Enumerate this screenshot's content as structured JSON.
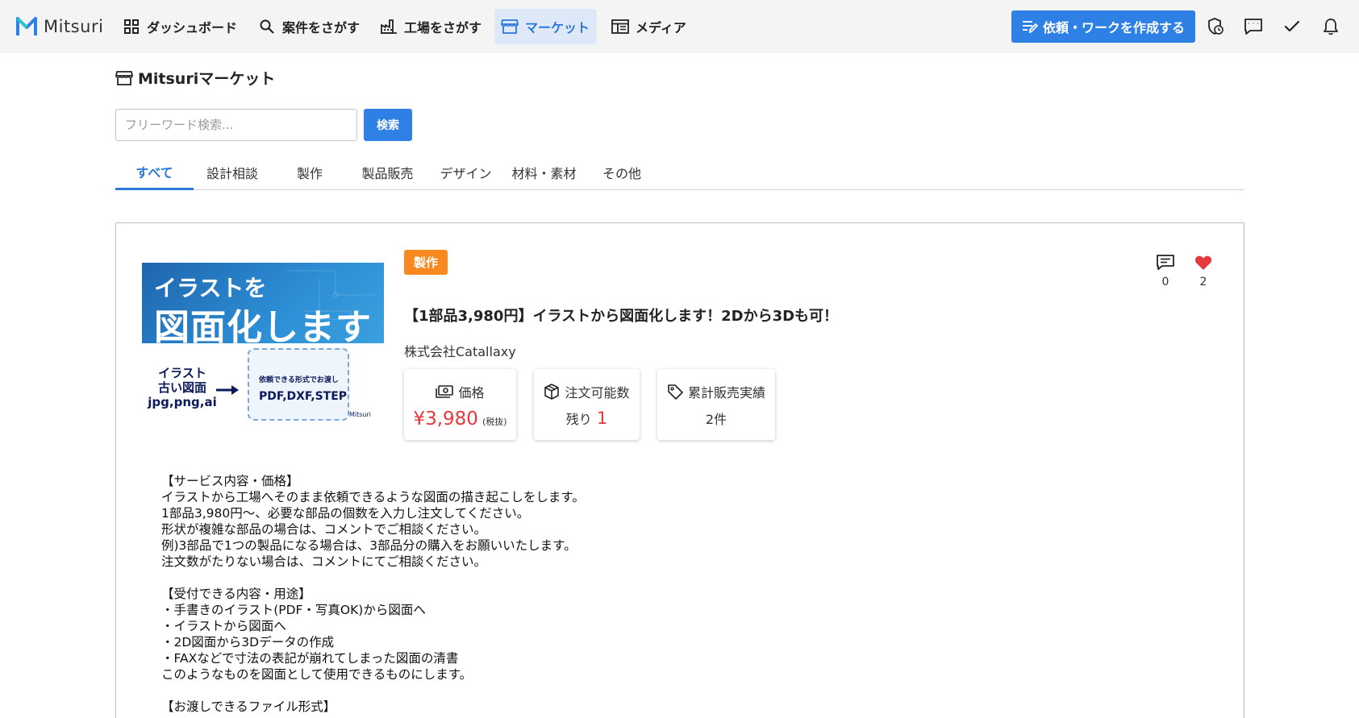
{
  "header": {
    "brand": "Mitsuri",
    "nav": [
      {
        "label": "ダッシュボード",
        "icon": "dashboard-grid-icon"
      },
      {
        "label": "案件をさがす",
        "icon": "search-icon"
      },
      {
        "label": "工場をさがす",
        "icon": "factory-icon"
      },
      {
        "label": "マーケット",
        "icon": "store-icon"
      },
      {
        "label": "メディア",
        "icon": "newspaper-icon"
      }
    ],
    "active_nav": "マーケット",
    "create_button": "依頼・ワークを作成する",
    "icons": [
      "shield-clock-icon",
      "message-icon",
      "check-icon",
      "bell-icon"
    ]
  },
  "page": {
    "title": "Mitsuriマーケット",
    "search": {
      "placeholder": "フリーワード検索...",
      "value": "",
      "button": "検索"
    },
    "tabs": [
      "すべて",
      "設計相談",
      "製作",
      "製品販売",
      "デザイン",
      "材料・素材",
      "その他"
    ],
    "active_tab": "すべて"
  },
  "listing": {
    "thumbnail": {
      "line1": "イラストを",
      "line2": "図面化します",
      "left_text": [
        "イラスト",
        "古い図面",
        "jpg,png,ai"
      ],
      "doc_small": "依頼できる形式でお渡し",
      "doc_big": "PDF,DXF,STEP",
      "brand": "Mitsuri"
    },
    "category": "製作",
    "title": "【1部品3,980円】イラストから図面化します！2Dから3Dも可！",
    "seller": "株式会社Catallaxy",
    "stats": {
      "price_label": "価格",
      "price_value": "¥3,980",
      "price_note": "(税抜)",
      "stock_label": "注文可能数",
      "stock_prefix": "残り",
      "stock_value": "1",
      "sales_label": "累計販売実績",
      "sales_value": "2件"
    },
    "comments_count": "0",
    "likes_count": "2",
    "description": [
      "【サービス内容・価格】",
      "イラストから工場へそのまま依頼できるような図面の描き起こしをします。",
      "1部品3,980円〜、必要な部品の個数を入力し注文してください。",
      "形状が複雑な部品の場合は、コメントでご相談ください。",
      "例)3部品で1つの製品になる場合は、3部品分の購入をお願いいたします。",
      "注文数がたりない場合は、コメントにてご相談ください。",
      "",
      "【受付できる内容・用途】",
      "・手書きのイラスト(PDF・写真OK)から図面へ",
      "・イラストから図面へ",
      "・2D図面から3Dデータの作成",
      "・FAXなどで寸法の表記が崩れてしまった図面の清書",
      "このようなものを図面として使用できるものにします。",
      "",
      "【お渡しできるファイル形式】"
    ]
  },
  "colors": {
    "primary": "#2f80e4",
    "active_nav_bg": "#dde9f8",
    "badge_orange": "#f7891f",
    "price_red": "#e5393f",
    "heart_red": "#e5393f",
    "topbar_bg": "#f4f4f5"
  }
}
